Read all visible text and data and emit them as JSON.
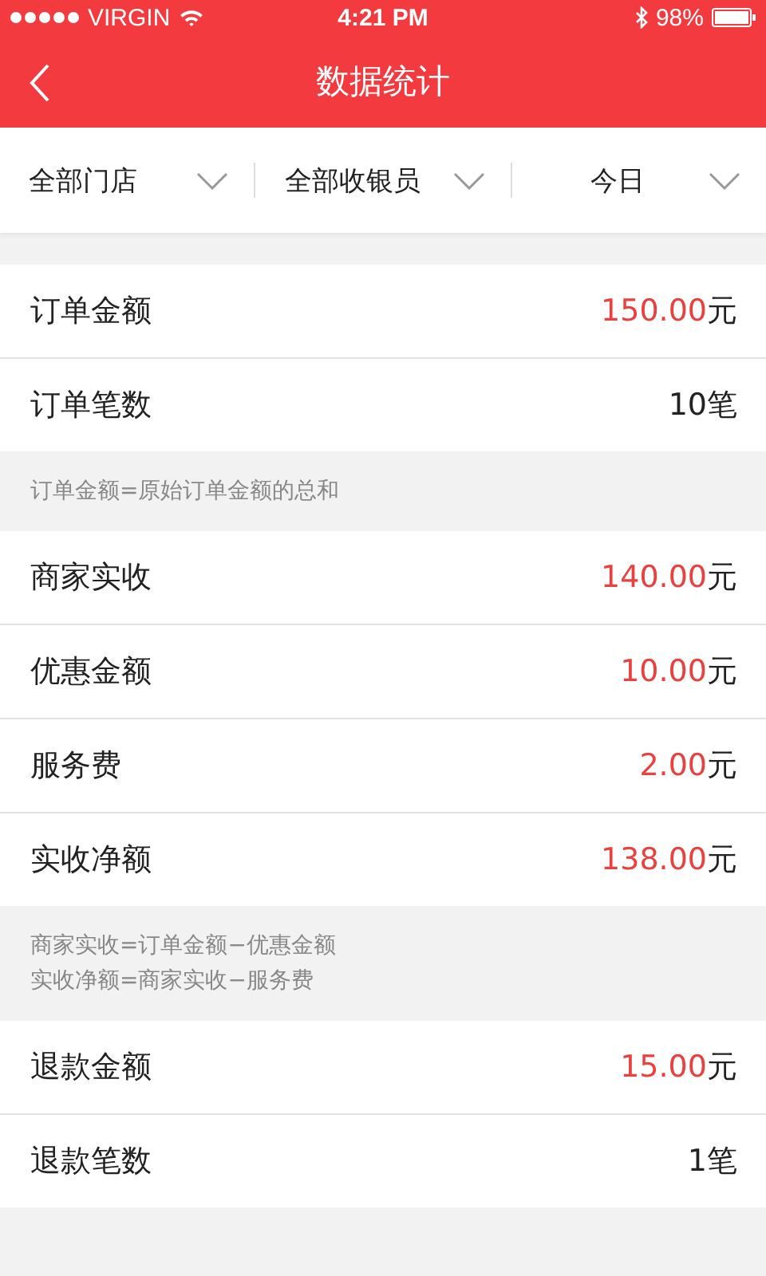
{
  "status_bar": {
    "carrier": "VIRGIN",
    "time": "4:21 PM",
    "battery": "98%"
  },
  "nav": {
    "title": "数据统计"
  },
  "filters": [
    {
      "label": "全部门店",
      "kind": "scope"
    },
    {
      "label": "全部收银员",
      "kind": "scope"
    },
    {
      "label": "今日",
      "kind": "period"
    }
  ],
  "sections": [
    {
      "rows": [
        {
          "label": "订单金额",
          "value": "150.00",
          "unit": "元",
          "kind": "amount"
        },
        {
          "label": "订单笔数",
          "value": "10",
          "unit": "笔",
          "kind": "count"
        }
      ],
      "notes": [
        "订单金额=原始订单金额的总和"
      ]
    },
    {
      "rows": [
        {
          "label": "商家实收",
          "value": "140.00",
          "unit": "元",
          "kind": "amount"
        },
        {
          "label": "优惠金额",
          "value": "10.00",
          "unit": "元",
          "kind": "amount"
        },
        {
          "label": "服务费",
          "value": "2.00",
          "unit": "元",
          "kind": "amount"
        },
        {
          "label": "实收净额",
          "value": "138.00",
          "unit": "元",
          "kind": "amount"
        }
      ],
      "notes": [
        "商家实收=订单金额−优惠金额",
        "实收净额=商家实收−服务费"
      ]
    },
    {
      "rows": [
        {
          "label": "退款金额",
          "value": "15.00",
          "unit": "元",
          "kind": "amount"
        },
        {
          "label": "退款笔数",
          "value": "1",
          "unit": "笔",
          "kind": "count"
        }
      ]
    }
  ]
}
